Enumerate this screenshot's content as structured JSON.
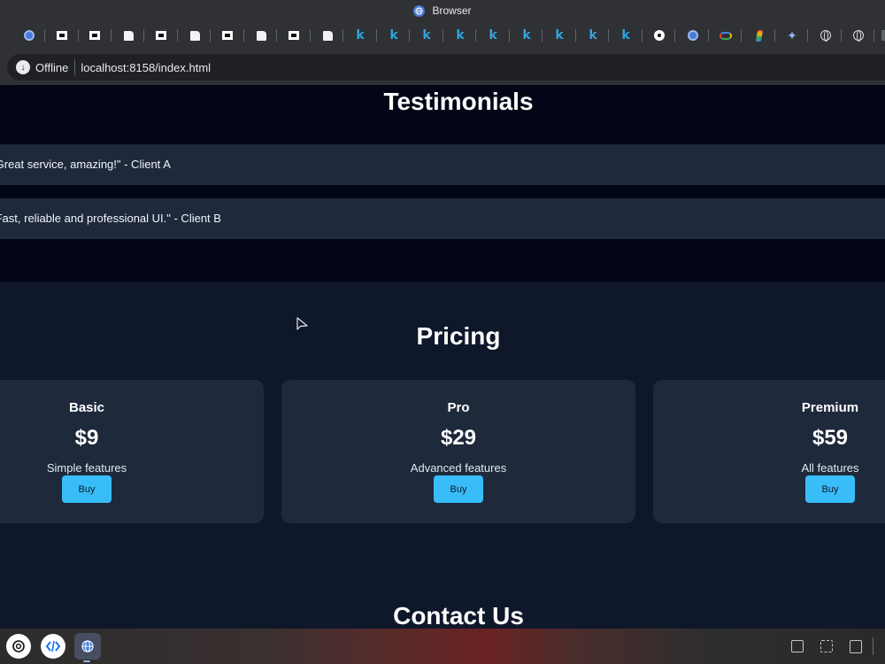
{
  "window": {
    "title": "Browser"
  },
  "tabs": [
    {
      "icon": "chrome-blue-icon"
    },
    {
      "icon": "black-square-icon"
    },
    {
      "icon": "black-square-icon"
    },
    {
      "icon": "white-doc-icon"
    },
    {
      "icon": "black-square-icon"
    },
    {
      "icon": "white-doc-icon"
    },
    {
      "icon": "black-square-icon"
    },
    {
      "icon": "white-doc-icon"
    },
    {
      "icon": "black-square-icon"
    },
    {
      "icon": "white-doc-icon"
    },
    {
      "icon": "k-icon",
      "glyph": "k"
    },
    {
      "icon": "k-icon",
      "glyph": "k"
    },
    {
      "icon": "k-icon",
      "glyph": "k"
    },
    {
      "icon": "k-icon",
      "glyph": "k"
    },
    {
      "icon": "k-icon",
      "glyph": "k"
    },
    {
      "icon": "k-icon",
      "glyph": "k"
    },
    {
      "icon": "k-icon",
      "glyph": "k"
    },
    {
      "icon": "k-icon",
      "glyph": "k"
    },
    {
      "icon": "k-icon",
      "glyph": "k"
    },
    {
      "icon": "target-icon"
    },
    {
      "icon": "chrome-blue-icon"
    },
    {
      "icon": "google-cloud-icon"
    },
    {
      "icon": "colors-icon"
    },
    {
      "icon": "sparkle-icon"
    },
    {
      "icon": "globe-icon"
    },
    {
      "icon": "globe-icon"
    },
    {
      "icon": "partial-tab-icon"
    }
  ],
  "address_bar": {
    "status": "Offline",
    "url": "localhost:8158/index.html"
  },
  "testimonials": {
    "title": "Testimonials",
    "items": [
      "\"Great service, amazing!\" - Client A",
      "\"Fast, reliable and professional UI.\" - Client B"
    ]
  },
  "pricing": {
    "title": "Pricing",
    "plans": [
      {
        "name": "Basic",
        "price": "$9",
        "features": "Simple features",
        "button": "Buy"
      },
      {
        "name": "Pro",
        "price": "$29",
        "features": "Advanced features",
        "button": "Buy"
      },
      {
        "name": "Premium",
        "price": "$59",
        "features": "All features",
        "button": "Buy"
      }
    ]
  },
  "contact": {
    "title": "Contact Us"
  },
  "colors": {
    "accent": "#38bdf8",
    "card_bg": "#1e293b",
    "page_bg": "#0f172a",
    "testimonials_bg": "#020617"
  },
  "shelf": {
    "apps": [
      "chatgpt-icon",
      "code-app-icon",
      "browser-icon"
    ],
    "tray": [
      "screen-capture-icon",
      "no-touch-icon",
      "clipboard-icon"
    ]
  }
}
